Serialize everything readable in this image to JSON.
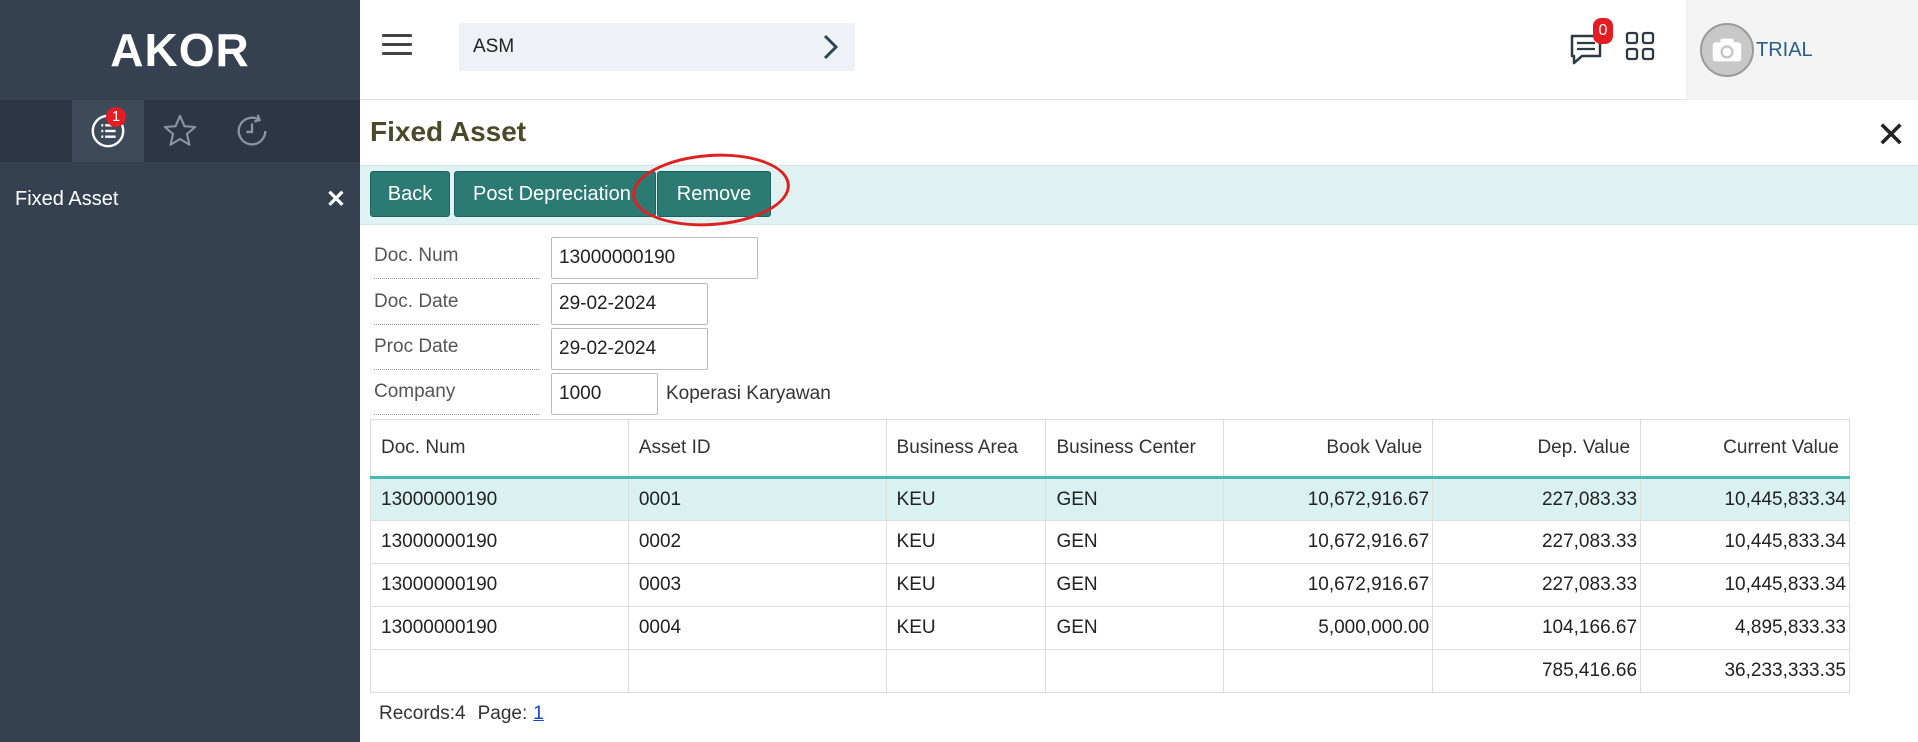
{
  "app": {
    "logo": "AKOR"
  },
  "sidebar": {
    "tabs": [
      {
        "name": "list",
        "badge": "1"
      },
      {
        "name": "favorites"
      },
      {
        "name": "history"
      }
    ],
    "open_item": {
      "label": "Fixed Asset",
      "close": "✕"
    }
  },
  "topbar": {
    "module": "ASM",
    "chat_badge": "0",
    "user": "TRIAL"
  },
  "page": {
    "title": "Fixed Asset",
    "close": "✕"
  },
  "toolbar": {
    "back": "Back",
    "post_depreciation": "Post Depreciation",
    "remove": "Remove"
  },
  "form": {
    "doc_num_label": "Doc. Num",
    "doc_num_value": "13000000190",
    "doc_date_label": "Doc. Date",
    "doc_date_value": "29-02-2024",
    "proc_date_label": "Proc Date",
    "proc_date_value": "29-02-2024",
    "company_label": "Company",
    "company_value": "1000",
    "company_name": "Koperasi Karyawan"
  },
  "table": {
    "headers": [
      "Doc. Num",
      "Asset ID",
      "Business Area",
      "Business Center",
      "Book Value",
      "Dep. Value",
      "Current Value"
    ],
    "rows": [
      [
        "13000000190",
        "0001",
        "KEU",
        "GEN",
        "10,672,916.67",
        "227,083.33",
        "10,445,833.34"
      ],
      [
        "13000000190",
        "0002",
        "KEU",
        "GEN",
        "10,672,916.67",
        "227,083.33",
        "10,445,833.34"
      ],
      [
        "13000000190",
        "0003",
        "KEU",
        "GEN",
        "10,672,916.67",
        "227,083.33",
        "10,445,833.34"
      ],
      [
        "13000000190",
        "0004",
        "KEU",
        "GEN",
        "5,000,000.00",
        "104,166.67",
        "4,895,833.33"
      ]
    ],
    "totals": [
      "",
      "",
      "",
      "",
      "",
      "785,416.66",
      "36,233,333.35"
    ]
  },
  "pager": {
    "records": "Records:4",
    "page_label": "Page:",
    "page_link": "1"
  },
  "colors": {
    "sidebar": "#354150",
    "accent": "#2b7a74",
    "toolbar_bg": "#dff1f1",
    "badge": "#e51c23",
    "highlight": "#e02020"
  }
}
